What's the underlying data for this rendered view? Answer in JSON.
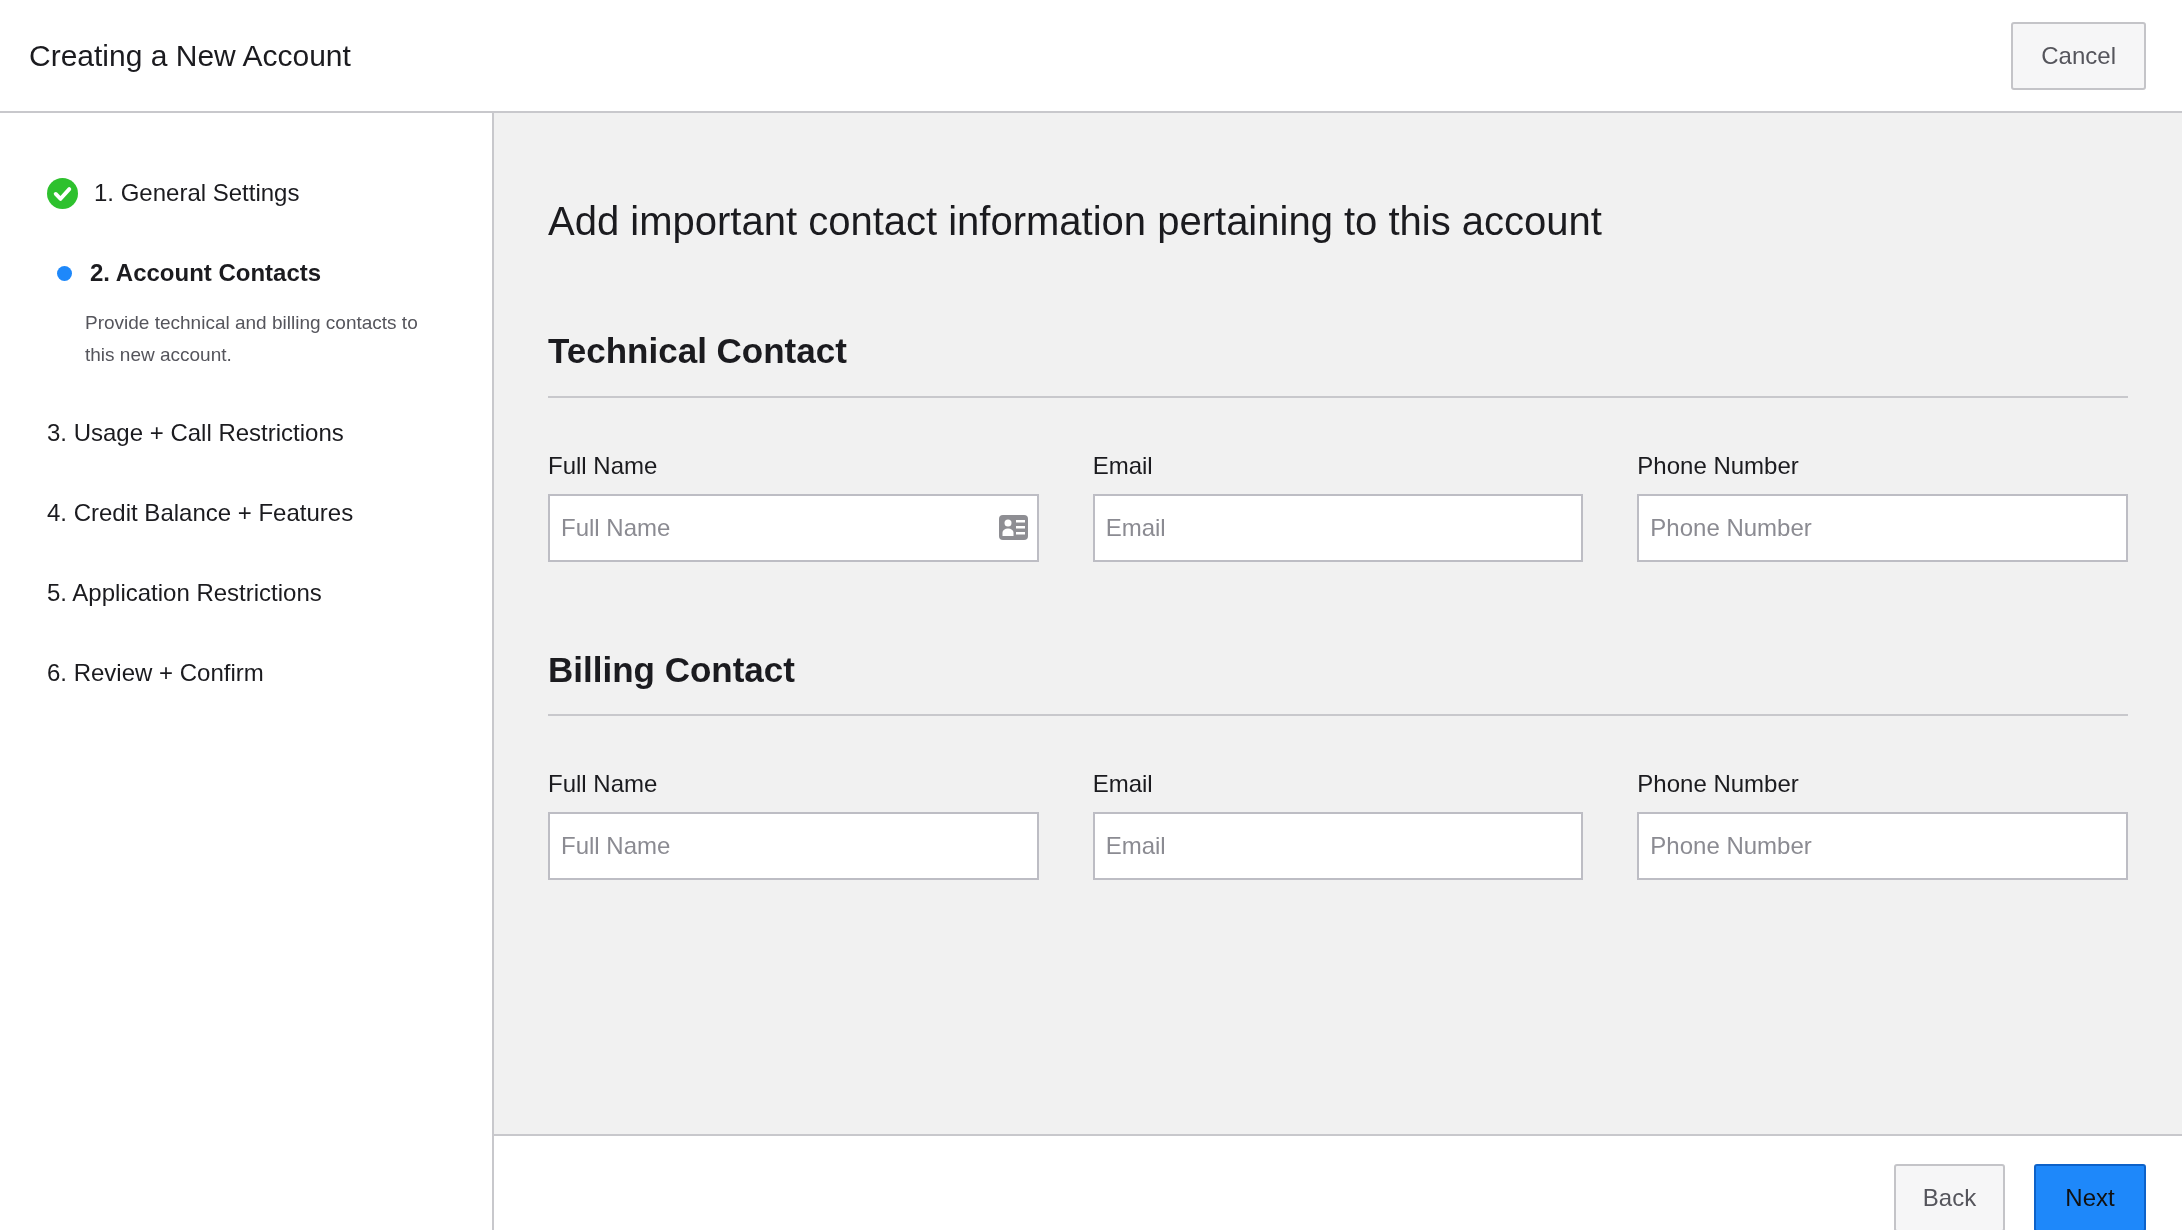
{
  "header": {
    "title": "Creating a New Account",
    "cancel_button": "Cancel"
  },
  "steps": [
    {
      "label": "1. General Settings",
      "completed": true,
      "selected": false
    },
    {
      "label": "2. Account Contacts",
      "completed": false,
      "selected": true,
      "description": "Provide technical and billing contacts to this new account."
    },
    {
      "label": "3. Usage + Call Restrictions",
      "completed": false,
      "selected": false
    },
    {
      "label": "4. Credit Balance + Features",
      "completed": false,
      "selected": false
    },
    {
      "label": "5. Application Restrictions",
      "completed": false,
      "selected": false
    },
    {
      "label": "6. Review + Confirm",
      "completed": false,
      "selected": false
    }
  ],
  "heading": "Add important contact information pertaining to this account",
  "sections": [
    {
      "title": "Technical Contact",
      "fields": [
        {
          "label": "Full Name",
          "placeholder": "Full Name",
          "contact_card_icon": true
        },
        {
          "label": "Email",
          "placeholder": "Email",
          "contact_card_icon": false
        },
        {
          "label": "Phone Number",
          "placeholder": "Phone Number",
          "contact_card_icon": false
        }
      ]
    },
    {
      "title": "Billing Contact",
      "fields": [
        {
          "label": "Full Name",
          "placeholder": "Full Name",
          "contact_card_icon": false
        },
        {
          "label": "Email",
          "placeholder": "Email",
          "contact_card_icon": false
        },
        {
          "label": "Phone Number",
          "placeholder": "Phone Number",
          "contact_card_icon": false
        }
      ]
    }
  ],
  "footer": {
    "back_button": "Back",
    "next_button": "Next"
  }
}
